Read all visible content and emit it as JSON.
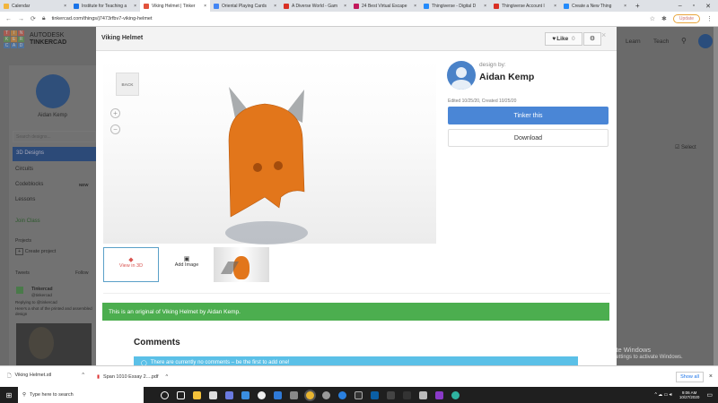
{
  "browser": {
    "tabs": [
      {
        "label": "Calendar",
        "color": "#f2b53c"
      },
      {
        "label": "Institute for Teaching a",
        "color": "#1a73e8"
      },
      {
        "label": "Viking Helmet | Tinker",
        "color": "#e2533c",
        "active": true
      },
      {
        "label": "Oriental Playing Cards",
        "color": "#4285f4"
      },
      {
        "label": "A Diverse World - Gam",
        "color": "#d93025"
      },
      {
        "label": "24 Best Virtual Escape",
        "color": "#c2185b"
      },
      {
        "label": "Thingiverse - Digital D",
        "color": "#248bfb"
      },
      {
        "label": "Thingiverse Account I",
        "color": "#d93025"
      },
      {
        "label": "Create a New Thing",
        "color": "#248bfb"
      }
    ],
    "url": "tinkercad.com/things/j7473rfbv7-viking-helmet",
    "update_label": "Update"
  },
  "background": {
    "brand_top": "AUTODESK",
    "brand_bottom": "TINKERCAD",
    "logo_letters": [
      "T",
      "I",
      "N",
      "K",
      "E",
      "R",
      "C",
      "A",
      "D"
    ],
    "user_name": "Aidan Kemp",
    "search_placeholder": "Search designs...",
    "nav": [
      "3D Designs",
      "Circuits",
      "Codeblocks",
      "Lessons"
    ],
    "new_badge": "NEW",
    "join_class": "Join Class",
    "projects_label": "Projects",
    "create_project": "Create project",
    "tweets_label": "Tweets",
    "follow_label": "Follow",
    "tweet_author": "Tinkercad",
    "tweet_handle": "@tinkercad",
    "tweet_reply": "Replying to @tinkercad",
    "tweet_text": "Here's a shot of the printed and assembled design",
    "top_nav": [
      "Learn",
      "Teach"
    ],
    "select_label": "Select",
    "watermark_title": "Activate Windows",
    "watermark_sub": "Go to Settings to activate Windows."
  },
  "modal": {
    "title": "Viking Helmet",
    "like_label": "Like",
    "like_count": "0",
    "back_label": "BACK",
    "designer_prefix": "design by:",
    "designer": "Aidan Kemp",
    "dates": "Edited 10/25/20, Created 10/25/20",
    "tinker_label": "Tinker this",
    "download_label": "Download",
    "view3d_label": "View in 3D",
    "add_image_label": "Add Image",
    "original_text": "This is an original of Viking Helmet by Aidan Kemp.",
    "comments_title": "Comments",
    "no_comments": "There are currently no comments – be the first to add one!"
  },
  "downloads": {
    "items": [
      "Viking Helmet.stl",
      "Span 1010 Essay 2....pdf"
    ],
    "show_all": "Show all"
  },
  "taskbar": {
    "search_placeholder": "Type here to search",
    "time": "9:06 AM",
    "date": "10/27/2020"
  }
}
